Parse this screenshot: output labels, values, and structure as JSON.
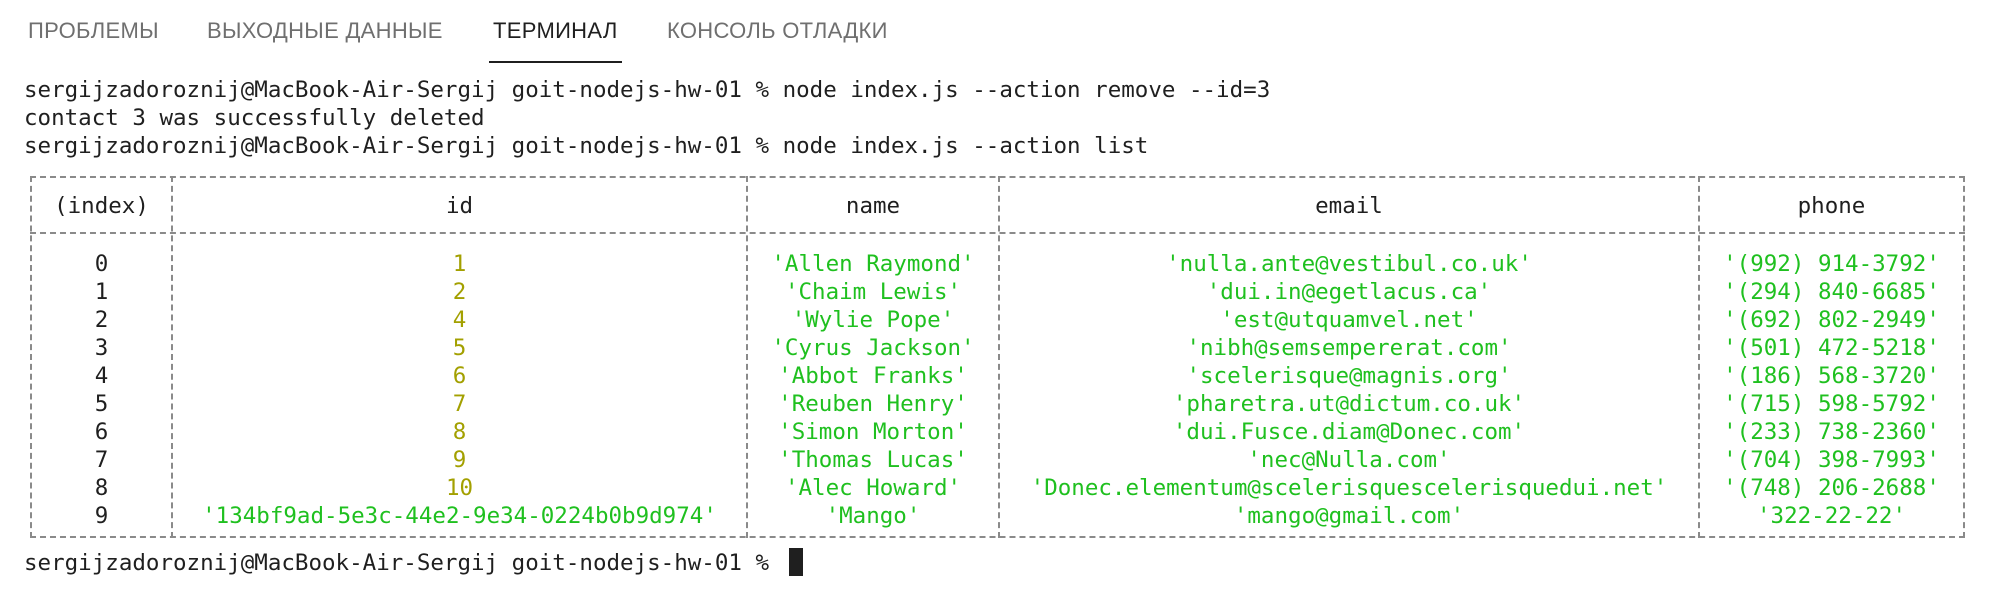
{
  "tabs": [
    {
      "label": "ПРОБЛЕМЫ",
      "active": false
    },
    {
      "label": "ВЫХОДНЫЕ ДАННЫЕ",
      "active": false
    },
    {
      "label": "ТЕРМИНАЛ",
      "active": true
    },
    {
      "label": "КОНСОЛЬ ОТЛАДКИ",
      "active": false
    }
  ],
  "terminal": {
    "lines": [
      "sergijzadoroznij@MacBook-Air-Sergij goit-nodejs-hw-01 % node index.js --action remove --id=3",
      "contact 3 was successfully deleted",
      "sergijzadoroznij@MacBook-Air-Sergij goit-nodejs-hw-01 % node index.js --action list"
    ],
    "prompt": "sergijzadoroznij@MacBook-Air-Sergij goit-nodejs-hw-01 % "
  },
  "table": {
    "headers": [
      "(index)",
      "id",
      "name",
      "email",
      "phone"
    ],
    "rows": [
      [
        "0",
        "1",
        "'Allen Raymond'",
        "'nulla.ante@vestibul.co.uk'",
        "'(992) 914-3792'"
      ],
      [
        "1",
        "2",
        "'Chaim Lewis'",
        "'dui.in@egetlacus.ca'",
        "'(294) 840-6685'"
      ],
      [
        "2",
        "4",
        "'Wylie Pope'",
        "'est@utquamvel.net'",
        "'(692) 802-2949'"
      ],
      [
        "3",
        "5",
        "'Cyrus Jackson'",
        "'nibh@semsempererat.com'",
        "'(501) 472-5218'"
      ],
      [
        "4",
        "6",
        "'Abbot Franks'",
        "'scelerisque@magnis.org'",
        "'(186) 568-3720'"
      ],
      [
        "5",
        "7",
        "'Reuben Henry'",
        "'pharetra.ut@dictum.co.uk'",
        "'(715) 598-5792'"
      ],
      [
        "6",
        "8",
        "'Simon Morton'",
        "'dui.Fusce.diam@Donec.com'",
        "'(233) 738-2360'"
      ],
      [
        "7",
        "9",
        "'Thomas Lucas'",
        "'nec@Nulla.com'",
        "'(704) 398-7993'"
      ],
      [
        "8",
        "10",
        "'Alec Howard'",
        "'Donec.elementum@scelerisquescelerisquedui.net'",
        "'(748) 206-2688'"
      ],
      [
        "9",
        "'134bf9ad-5e3c-44e2-9e34-0224b0b9d974'",
        "'Mango'",
        "'mango@gmail.com'",
        "'322-22-22'"
      ]
    ]
  },
  "colors": {
    "string": "#1fc01f",
    "number": "#a3a000",
    "text": "#1f1f1f",
    "inactive_tab": "#6f6f6f"
  }
}
